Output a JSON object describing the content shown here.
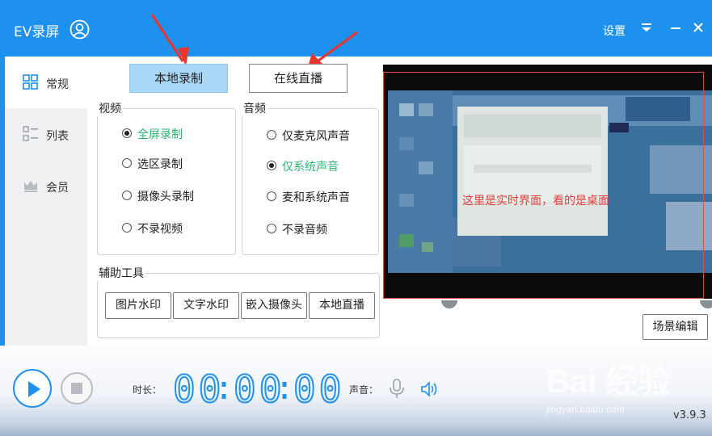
{
  "app": {
    "title": "EV录屏",
    "settings_label": "设置"
  },
  "sidebar": {
    "items": [
      {
        "label": "常规",
        "icon": "grid-icon"
      },
      {
        "label": "列表",
        "icon": "list-icon"
      },
      {
        "label": "会员",
        "icon": "crown-icon"
      }
    ]
  },
  "mode_buttons": {
    "local_record": "本地录制",
    "online_live": "在线直播"
  },
  "video": {
    "title": "视频",
    "options": [
      "全屏录制",
      "选区录制",
      "摄像头录制",
      "不录视频"
    ],
    "selected_index": 0
  },
  "audio": {
    "title": "音频",
    "options": [
      "仅麦克风声音",
      "仅系统声音",
      "麦和系统声音",
      "不录音频"
    ],
    "selected_index": 1
  },
  "tools": {
    "title": "辅助工具",
    "buttons": [
      "图片水印",
      "文字水印",
      "嵌入摄像头",
      "本地直播"
    ]
  },
  "preview": {
    "note": "这里是实时界面，看的是桌面"
  },
  "scene_edit_label": "场景编辑",
  "bottom": {
    "duration_label": "时长：",
    "timer": [
      "00",
      "00",
      "00"
    ],
    "sound_label": "声音：",
    "version": "v3.9.3"
  },
  "watermark": {
    "brand": "Bai 经验",
    "url": "jingyan.baidu.com"
  },
  "colors": {
    "primary": "#1e91ee",
    "selected_text": "#2bb673",
    "note_red": "#e23b3b"
  }
}
